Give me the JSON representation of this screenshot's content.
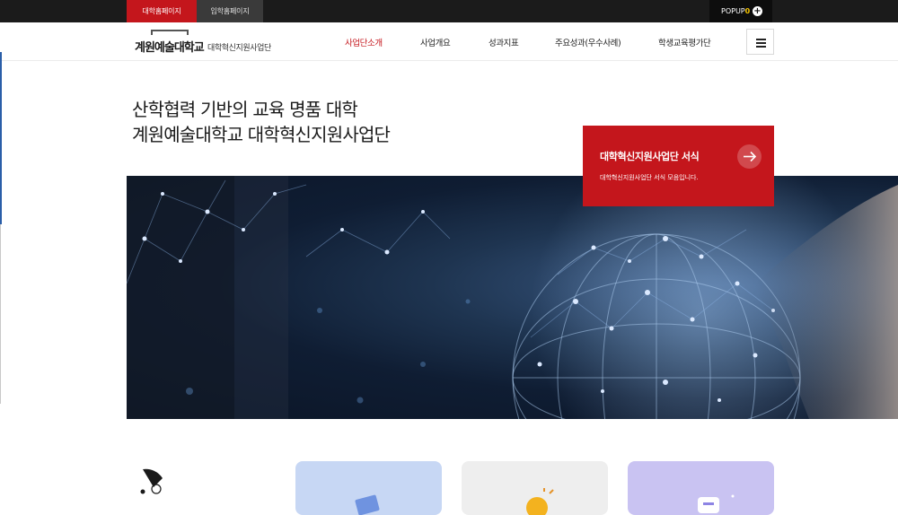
{
  "topbar": {
    "tabs": [
      {
        "label": "대학홈페이지"
      },
      {
        "label": "입학홈페이지"
      }
    ],
    "popup_label": "POPUP",
    "popup_count": "0"
  },
  "header": {
    "logo_name": "계원예술대학교",
    "logo_sub": "대학혁신지원사업단",
    "nav": [
      {
        "label": "사업단소개",
        "active": true
      },
      {
        "label": "사업개요"
      },
      {
        "label": "성과지표"
      },
      {
        "label": "주요성과(우수사례)"
      },
      {
        "label": "학생교육평가단"
      }
    ]
  },
  "hero": {
    "title_line1": "산학협력 기반의 교육 명품 대학",
    "title_line2": "계원예술대학교 대학혁신지원사업단"
  },
  "card": {
    "title": "대학혁신지원사업단 서식",
    "desc": "대학혁신지원사업단 서식 모음입니다."
  },
  "colors": {
    "accent": "#c4161c",
    "topbar": "#1b1b1b",
    "card1": "#c7d7f4",
    "card2": "#eeeeee",
    "card3": "#c9c3f2"
  },
  "icons": {
    "popup": "plus-circle-icon",
    "card_arrow": "arrow-right-icon",
    "menu": "hamburger-icon"
  }
}
